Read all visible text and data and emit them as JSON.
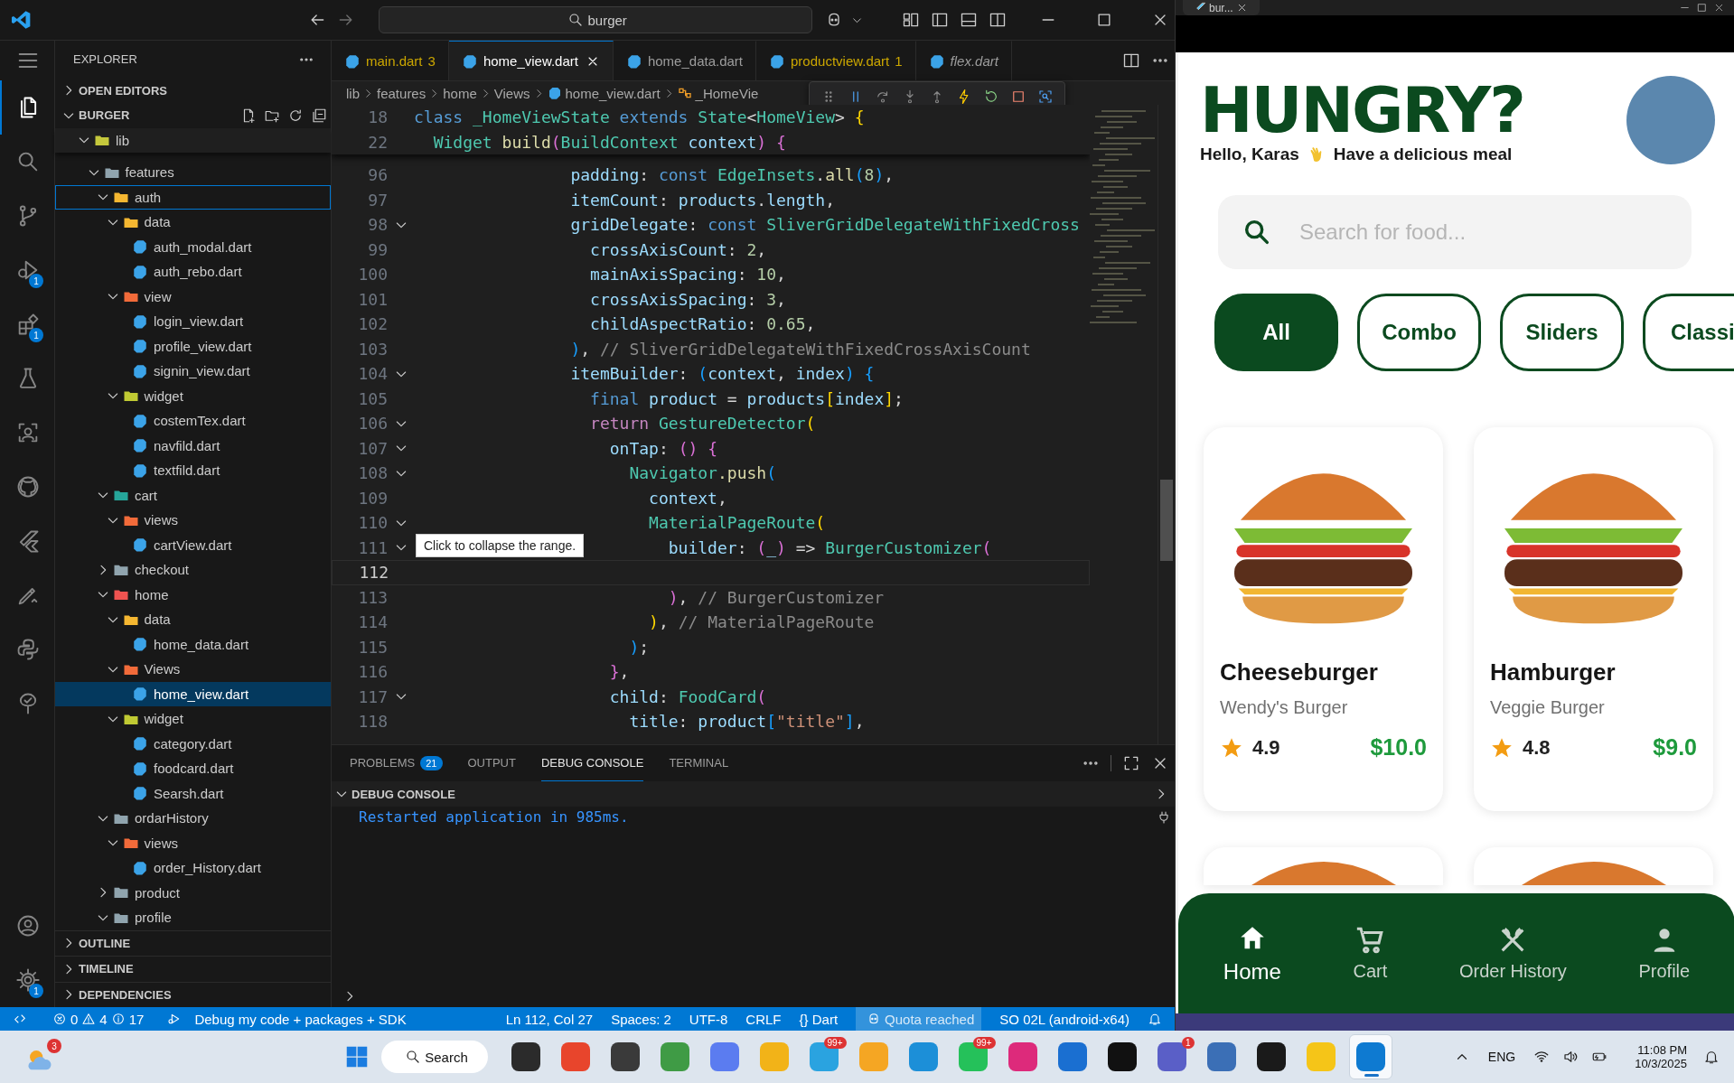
{
  "title_bar": {
    "search": "burger"
  },
  "activity_bar": {
    "items": [
      {
        "selected": false
      },
      {
        "selected": true
      },
      {
        "selected": false
      },
      {
        "selected": false
      },
      {
        "selected": false,
        "badge": "1"
      },
      {
        "selected": false,
        "badge": "1"
      },
      {
        "selected": false
      },
      {
        "selected": false
      },
      {
        "selected": false
      },
      {
        "selected": false
      },
      {
        "selected": false
      },
      {
        "selected": false
      },
      {
        "selected": false
      }
    ],
    "bottom": [
      {
        "selected": false
      },
      {
        "selected": false,
        "badge": "1"
      }
    ]
  },
  "explorer": {
    "title": "EXPLORER",
    "top_sections": [
      {
        "label": "OPEN EDITORS",
        "expanded": false
      }
    ],
    "workspace": {
      "label": "BURGER",
      "expanded": true
    },
    "tree": [
      {
        "name": "lib",
        "kind": "folder",
        "color": "#c5c83c",
        "expanded": true,
        "selected": false,
        "focused": false,
        "children": [
          {
            "name": "features",
            "kind": "folder",
            "color": "#90a4ae",
            "expanded": true,
            "selected": false,
            "focused": false,
            "children": [
              {
                "name": "auth",
                "kind": "folder",
                "color": "#f5b731",
                "expanded": true,
                "selected": false,
                "focused": true,
                "children": [
                  {
                    "name": "data",
                    "kind": "folder",
                    "color": "#f5b731",
                    "expanded": true,
                    "selected": false,
                    "focused": false,
                    "children": [
                      {
                        "name": "auth_modal.dart",
                        "kind": "file",
                        "selected": false,
                        "focused": false
                      },
                      {
                        "name": "auth_rebo.dart",
                        "kind": "file",
                        "selected": false,
                        "focused": false
                      }
                    ]
                  },
                  {
                    "name": "view",
                    "kind": "folder",
                    "color": "#f26b3a",
                    "expanded": true,
                    "selected": false,
                    "focused": false,
                    "children": [
                      {
                        "name": "login_view.dart",
                        "kind": "file",
                        "selected": false,
                        "focused": false
                      },
                      {
                        "name": "profile_view.dart",
                        "kind": "file",
                        "selected": false,
                        "focused": false
                      },
                      {
                        "name": "signin_view.dart",
                        "kind": "file",
                        "selected": false,
                        "focused": false
                      }
                    ]
                  },
                  {
                    "name": "widget",
                    "kind": "folder",
                    "color": "#c0ca33",
                    "expanded": true,
                    "selected": false,
                    "focused": false,
                    "children": [
                      {
                        "name": "costemTex.dart",
                        "kind": "file",
                        "selected": false,
                        "focused": false
                      },
                      {
                        "name": "navfild.dart",
                        "kind": "file",
                        "selected": false,
                        "focused": false
                      },
                      {
                        "name": "textfild.dart",
                        "kind": "file",
                        "selected": false,
                        "focused": false
                      }
                    ]
                  }
                ]
              },
              {
                "name": "cart",
                "kind": "folder",
                "color": "#26a69a",
                "expanded": true,
                "selected": false,
                "focused": false,
                "children": [
                  {
                    "name": "views",
                    "kind": "folder",
                    "color": "#f26b3a",
                    "expanded": true,
                    "selected": false,
                    "focused": false,
                    "children": [
                      {
                        "name": "cartView.dart",
                        "kind": "file",
                        "selected": false,
                        "focused": false
                      }
                    ]
                  }
                ]
              },
              {
                "name": "checkout",
                "kind": "folder",
                "color": "#90a4ae",
                "expanded": false,
                "selected": false,
                "focused": false
              },
              {
                "name": "home",
                "kind": "folder",
                "color": "#ef5350",
                "expanded": true,
                "selected": false,
                "focused": false,
                "children": [
                  {
                    "name": "data",
                    "kind": "folder",
                    "color": "#f5b731",
                    "expanded": true,
                    "selected": false,
                    "focused": false,
                    "children": [
                      {
                        "name": "home_data.dart",
                        "kind": "file",
                        "selected": false,
                        "focused": false
                      }
                    ]
                  },
                  {
                    "name": "Views",
                    "kind": "folder",
                    "color": "#f26b3a",
                    "expanded": true,
                    "selected": false,
                    "focused": false,
                    "children": [
                      {
                        "name": "home_view.dart",
                        "kind": "file",
                        "selected": true,
                        "focused": false
                      }
                    ]
                  },
                  {
                    "name": "widget",
                    "kind": "folder",
                    "color": "#c0ca33",
                    "expanded": true,
                    "selected": false,
                    "focused": false,
                    "children": [
                      {
                        "name": "category.dart",
                        "kind": "file",
                        "selected": false,
                        "focused": false
                      },
                      {
                        "name": "foodcard.dart",
                        "kind": "file",
                        "selected": false,
                        "focused": false
                      },
                      {
                        "name": "Searsh.dart",
                        "kind": "file",
                        "selected": false,
                        "focused": false
                      }
                    ]
                  }
                ]
              },
              {
                "name": "ordarHistory",
                "kind": "folder",
                "color": "#90a4ae",
                "expanded": true,
                "selected": false,
                "focused": false,
                "children": [
                  {
                    "name": "views",
                    "kind": "folder",
                    "color": "#f26b3a",
                    "expanded": true,
                    "selected": false,
                    "focused": false,
                    "children": [
                      {
                        "name": "order_History.dart",
                        "kind": "file",
                        "selected": false,
                        "focused": false
                      }
                    ]
                  }
                ]
              },
              {
                "name": "product",
                "kind": "folder",
                "color": "#90a4ae",
                "expanded": false,
                "selected": false,
                "focused": false
              },
              {
                "name": "profile",
                "kind": "folder",
                "color": "#90a4ae",
                "expanded": true,
                "selected": false,
                "focused": false
              }
            ]
          }
        ]
      }
    ],
    "bottom_sections": [
      {
        "label": "OUTLINE",
        "expanded": false
      },
      {
        "label": "TIMELINE",
        "expanded": false
      },
      {
        "label": "DEPENDENCIES",
        "expanded": false
      }
    ]
  },
  "tabs": [
    {
      "label": "main.dart",
      "badge": "3",
      "warning": true,
      "preview": false,
      "selected": false
    },
    {
      "label": "home_view.dart",
      "warning": false,
      "preview": false,
      "selected": true
    },
    {
      "label": "home_data.dart",
      "warning": false,
      "preview": false,
      "selected": false
    },
    {
      "label": "productview.dart",
      "badge": "1",
      "warning": true,
      "preview": false,
      "selected": false
    },
    {
      "label": "flex.dart",
      "warning": false,
      "preview": true,
      "selected": false
    }
  ],
  "breadcrumb": [
    {
      "label": "lib",
      "kind": "folder"
    },
    {
      "label": "features",
      "kind": "folder"
    },
    {
      "label": "home",
      "kind": "folder"
    },
    {
      "label": "Views",
      "kind": "folder"
    },
    {
      "label": "home_view.dart",
      "kind": "file"
    },
    {
      "label": "_HomeVie",
      "kind": "symbol"
    }
  ],
  "editor": {
    "sticky_lines": [
      {
        "number": "18",
        "tokens": [
          {
            "kind": "kw",
            "text": "class "
          },
          {
            "kind": "type",
            "text": "_HomeViewState "
          },
          {
            "kind": "kw",
            "text": "extends "
          },
          {
            "kind": "type",
            "text": "State"
          },
          {
            "kind": "plain",
            "text": "<"
          },
          {
            "kind": "type",
            "text": "HomeView"
          },
          {
            "kind": "plain",
            "text": "> "
          },
          {
            "kind": "br1",
            "text": "{"
          }
        ]
      },
      {
        "number": "22",
        "tokens": [
          {
            "kind": "type",
            "text": "  Widget "
          },
          {
            "kind": "fn",
            "text": "build"
          },
          {
            "kind": "br2",
            "text": "("
          },
          {
            "kind": "type",
            "text": "BuildContext "
          },
          {
            "kind": "prop",
            "text": "context"
          },
          {
            "kind": "br2",
            "text": ") "
          },
          {
            "kind": "br2",
            "text": "{"
          }
        ]
      }
    ],
    "lines": [
      {
        "number": "96",
        "fold": false,
        "current": false,
        "tokens": [
          {
            "kind": "prop",
            "text": "                padding"
          },
          {
            "kind": "plain",
            "text": ": "
          },
          {
            "kind": "kw",
            "text": "const "
          },
          {
            "kind": "type",
            "text": "EdgeInsets"
          },
          {
            "kind": "plain",
            "text": "."
          },
          {
            "kind": "fn",
            "text": "all"
          },
          {
            "kind": "br3",
            "text": "("
          },
          {
            "kind": "num",
            "text": "8"
          },
          {
            "kind": "br3",
            "text": ")"
          },
          {
            "kind": "plain",
            "text": ","
          }
        ]
      },
      {
        "number": "97",
        "fold": false,
        "current": false,
        "tokens": [
          {
            "kind": "prop",
            "text": "                itemCount"
          },
          {
            "kind": "plain",
            "text": ": "
          },
          {
            "kind": "prop",
            "text": "products"
          },
          {
            "kind": "plain",
            "text": "."
          },
          {
            "kind": "prop",
            "text": "length"
          },
          {
            "kind": "plain",
            "text": ","
          }
        ]
      },
      {
        "number": "98",
        "fold": true,
        "current": false,
        "tokens": [
          {
            "kind": "prop",
            "text": "                gridDelegate"
          },
          {
            "kind": "plain",
            "text": ": "
          },
          {
            "kind": "kw",
            "text": "const "
          },
          {
            "kind": "type",
            "text": "SliverGridDelegateWithFixedCross"
          }
        ]
      },
      {
        "number": "99",
        "fold": false,
        "current": false,
        "tokens": [
          {
            "kind": "prop",
            "text": "                  crossAxisCount"
          },
          {
            "kind": "plain",
            "text": ": "
          },
          {
            "kind": "num",
            "text": "2"
          },
          {
            "kind": "plain",
            "text": ","
          }
        ]
      },
      {
        "number": "100",
        "fold": false,
        "current": false,
        "tokens": [
          {
            "kind": "prop",
            "text": "                  mainAxisSpacing"
          },
          {
            "kind": "plain",
            "text": ": "
          },
          {
            "kind": "num",
            "text": "10"
          },
          {
            "kind": "plain",
            "text": ","
          }
        ]
      },
      {
        "number": "101",
        "fold": false,
        "current": false,
        "tokens": [
          {
            "kind": "prop",
            "text": "                  crossAxisSpacing"
          },
          {
            "kind": "plain",
            "text": ": "
          },
          {
            "kind": "num",
            "text": "3"
          },
          {
            "kind": "plain",
            "text": ","
          }
        ]
      },
      {
        "number": "102",
        "fold": false,
        "current": false,
        "tokens": [
          {
            "kind": "prop",
            "text": "                  childAspectRatio"
          },
          {
            "kind": "plain",
            "text": ": "
          },
          {
            "kind": "num",
            "text": "0.65"
          },
          {
            "kind": "plain",
            "text": ","
          }
        ]
      },
      {
        "number": "103",
        "fold": false,
        "current": false,
        "tokens": [
          {
            "kind": "br3",
            "text": "                )"
          },
          {
            "kind": "plain",
            "text": ", "
          },
          {
            "kind": "comment",
            "text": "// SliverGridDelegateWithFixedCrossAxisCount"
          }
        ]
      },
      {
        "number": "104",
        "fold": true,
        "current": false,
        "tokens": [
          {
            "kind": "prop",
            "text": "                itemBuilder"
          },
          {
            "kind": "plain",
            "text": ": "
          },
          {
            "kind": "br3",
            "text": "("
          },
          {
            "kind": "prop",
            "text": "context"
          },
          {
            "kind": "plain",
            "text": ", "
          },
          {
            "kind": "prop",
            "text": "index"
          },
          {
            "kind": "br3",
            "text": ") "
          },
          {
            "kind": "br3",
            "text": "{"
          }
        ]
      },
      {
        "number": "105",
        "fold": false,
        "current": false,
        "tokens": [
          {
            "kind": "kw",
            "text": "                  final "
          },
          {
            "kind": "prop",
            "text": "product"
          },
          {
            "kind": "plain",
            "text": " = "
          },
          {
            "kind": "prop",
            "text": "products"
          },
          {
            "kind": "br1",
            "text": "["
          },
          {
            "kind": "prop",
            "text": "index"
          },
          {
            "kind": "br1",
            "text": "]"
          },
          {
            "kind": "plain",
            "text": ";"
          }
        ]
      },
      {
        "number": "106",
        "fold": true,
        "current": false,
        "tokens": [
          {
            "kind": "kw2",
            "text": "                  return "
          },
          {
            "kind": "type",
            "text": "GestureDetector"
          },
          {
            "kind": "br1",
            "text": "("
          }
        ]
      },
      {
        "number": "107",
        "fold": true,
        "current": false,
        "tokens": [
          {
            "kind": "prop",
            "text": "                    onTap"
          },
          {
            "kind": "plain",
            "text": ": "
          },
          {
            "kind": "br2",
            "text": "() "
          },
          {
            "kind": "br2",
            "text": "{"
          }
        ]
      },
      {
        "number": "108",
        "fold": true,
        "current": false,
        "tokens": [
          {
            "kind": "type",
            "text": "                      Navigator"
          },
          {
            "kind": "fn",
            "text": ".push"
          },
          {
            "kind": "br3",
            "text": "("
          }
        ]
      },
      {
        "number": "109",
        "fold": false,
        "current": false,
        "tokens": [
          {
            "kind": "prop",
            "text": "                        context"
          },
          {
            "kind": "plain",
            "text": ","
          }
        ]
      },
      {
        "number": "110",
        "fold": true,
        "current": false,
        "tokens": [
          {
            "kind": "type",
            "text": "                        MaterialPageRoute"
          },
          {
            "kind": "br1",
            "text": "("
          }
        ]
      },
      {
        "number": "111",
        "fold": true,
        "current": false,
        "tokens": [
          {
            "kind": "prop",
            "text": "                          builder"
          },
          {
            "kind": "plain",
            "text": ": "
          },
          {
            "kind": "br2",
            "text": "("
          },
          {
            "kind": "prop",
            "text": "_"
          },
          {
            "kind": "br2",
            "text": ")"
          },
          {
            "kind": "plain",
            "text": " => "
          },
          {
            "kind": "type",
            "text": "BurgerCustomizer"
          },
          {
            "kind": "br2",
            "text": "("
          }
        ]
      },
      {
        "number": "112",
        "fold": false,
        "current": true
      },
      {
        "number": "113",
        "fold": false,
        "current": false,
        "tokens": [
          {
            "kind": "br2",
            "text": "                          )"
          },
          {
            "kind": "plain",
            "text": ", "
          },
          {
            "kind": "comment",
            "text": "// BurgerCustomizer"
          }
        ]
      },
      {
        "number": "114",
        "fold": false,
        "current": false,
        "tokens": [
          {
            "kind": "br1",
            "text": "                        )"
          },
          {
            "kind": "plain",
            "text": ", "
          },
          {
            "kind": "comment",
            "text": "// MaterialPageRoute"
          }
        ]
      },
      {
        "number": "115",
        "fold": false,
        "current": false,
        "tokens": [
          {
            "kind": "br3",
            "text": "                      )"
          },
          {
            "kind": "plain",
            "text": ";"
          }
        ]
      },
      {
        "number": "116",
        "fold": false,
        "current": false,
        "tokens": [
          {
            "kind": "br2",
            "text": "                    }"
          },
          {
            "kind": "plain",
            "text": ","
          }
        ]
      },
      {
        "number": "117",
        "fold": true,
        "current": false,
        "tokens": [
          {
            "kind": "prop",
            "text": "                    child"
          },
          {
            "kind": "plain",
            "text": ": "
          },
          {
            "kind": "type",
            "text": "FoodCard"
          },
          {
            "kind": "br2",
            "text": "("
          }
        ]
      },
      {
        "number": "118",
        "fold": false,
        "current": false,
        "tokens": [
          {
            "kind": "prop",
            "text": "                      title"
          },
          {
            "kind": "plain",
            "text": ": "
          },
          {
            "kind": "prop",
            "text": "product"
          },
          {
            "kind": "br3",
            "text": "["
          },
          {
            "kind": "str",
            "text": "\"title\""
          },
          {
            "kind": "br3",
            "text": "]"
          },
          {
            "kind": "plain",
            "text": ","
          }
        ]
      }
    ],
    "tooltip": "Click to collapse the range."
  },
  "panel": {
    "tabs": [
      {
        "label": "PROBLEMS",
        "badge": "21",
        "selected": false
      },
      {
        "label": "OUTPUT",
        "selected": false
      },
      {
        "label": "DEBUG CONSOLE",
        "selected": true
      },
      {
        "label": "TERMINAL",
        "selected": false
      }
    ],
    "section": {
      "label": "DEBUG CONSOLE",
      "expanded": true
    },
    "output": [
      "Restarted application in 985ms."
    ]
  },
  "status_bar": {
    "errors": "0",
    "warnings": "4",
    "infos": "17",
    "debug_profile": "Debug my code + packages + SDK",
    "right": [
      {
        "text": "Ln 112, Col 27",
        "kind": "plain"
      },
      {
        "text": "Spaces: 2",
        "kind": "plain"
      },
      {
        "text": "UTF-8",
        "kind": "plain"
      },
      {
        "text": "CRLF",
        "kind": "plain"
      },
      {
        "text": "{} Dart",
        "kind": "plain"
      },
      {
        "text": "Quota reached",
        "kind": "quota"
      },
      {
        "text": "SO 02L (android-x64)",
        "kind": "plain"
      }
    ]
  },
  "app_window": {
    "tab": "bur...",
    "app": {
      "title": "HUNGRY?",
      "greeting": "Hello, Karas",
      "greeting_tail": "Have a delicious meal",
      "search_placeholder": "Search for food...",
      "categories": [
        {
          "label": "All",
          "selected": true
        },
        {
          "label": "Combo",
          "selected": false
        },
        {
          "label": "Sliders",
          "selected": false
        },
        {
          "label": "Classi",
          "selected": false
        }
      ],
      "products": [
        {
          "title": "Cheeseburger",
          "subtitle": "Wendy's Burger",
          "rating": "4.9",
          "price": "$10.0"
        },
        {
          "title": "Hamburger",
          "subtitle": "Veggie Burger",
          "rating": "4.8",
          "price": "$9.0"
        }
      ],
      "nav": [
        {
          "label": "Home",
          "selected": true
        },
        {
          "label": "Cart",
          "selected": false
        },
        {
          "label": "Order History",
          "selected": false
        },
        {
          "label": "Profile",
          "selected": false
        }
      ]
    }
  },
  "taskbar": {
    "weather_badge": "3",
    "search": "Search",
    "apps": [
      {
        "color": "#2b2b2b",
        "selected": false
      },
      {
        "color": "#e8452c",
        "selected": false
      },
      {
        "color": "#3a3a3a",
        "selected": false
      },
      {
        "color": "#3f9b45",
        "selected": false
      },
      {
        "color": "#5b7cf0",
        "selected": false
      },
      {
        "color": "#f2b318",
        "selected": false
      },
      {
        "color": "#2aa3e0",
        "selected": false,
        "badge": "99+"
      },
      {
        "color": "#f5a623",
        "selected": false
      },
      {
        "color": "#1c8fd8",
        "selected": false
      },
      {
        "color": "#25c15a",
        "selected": false,
        "badge": "99+"
      },
      {
        "color": "#dd2a7b",
        "selected": false
      },
      {
        "color": "#1a6fd1",
        "selected": false
      },
      {
        "color": "#111111",
        "selected": false
      },
      {
        "color": "#5a5fc7",
        "selected": false,
        "badge": "1"
      },
      {
        "color": "#3b6fb6",
        "selected": false
      },
      {
        "color": "#1a1a1a",
        "selected": false
      },
      {
        "color": "#f5c518",
        "selected": false
      },
      {
        "color": "#0e7ad1",
        "selected": true
      }
    ],
    "language": "ENG",
    "time": "11:08 PM",
    "date": "10/3/2025"
  }
}
